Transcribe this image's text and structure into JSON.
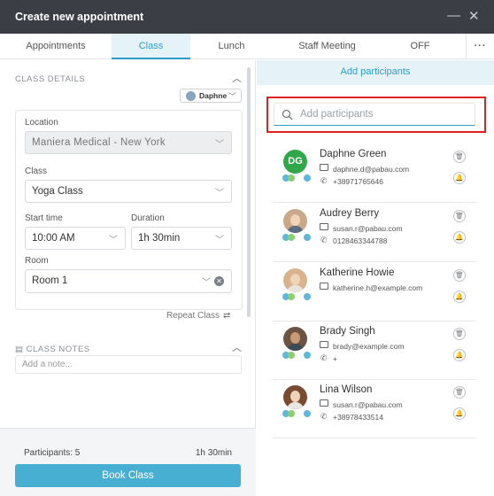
{
  "window": {
    "title": "Create new appointment",
    "minimize_glyph": "—",
    "close_glyph": "✕"
  },
  "tabs": [
    {
      "label": "Appointments"
    },
    {
      "label": "Class"
    },
    {
      "label": "Lunch"
    },
    {
      "label": "Staff Meeting"
    },
    {
      "label": "OFF"
    },
    {
      "label": "···"
    }
  ],
  "class_details": {
    "section_label": "CLASS DETAILS",
    "staff": "Daphne",
    "location_label": "Location",
    "location_value": "Maniera Medical - New York",
    "class_label": "Class",
    "class_value": "Yoga Class",
    "start_label": "Start time",
    "start_value": "10:00 AM",
    "duration_label": "Duration",
    "duration_value": "1h 30min",
    "room_label": "Room",
    "room_value": "Room 1",
    "repeat_label": "Repeat Class"
  },
  "class_notes": {
    "section_label": "CLASS NOTES",
    "placeholder": "Add a note..."
  },
  "footer": {
    "participants_text": "Participants: 5",
    "duration_text": "1h 30min",
    "book_button": "Book Class"
  },
  "participants_panel": {
    "header": "Add participants",
    "search_placeholder": "Add participants",
    "participants": [
      {
        "name": "Daphne Green",
        "initials": "DG",
        "email": "daphne.d@pabau.com",
        "phone": "+38971765646",
        "avatar": "initials"
      },
      {
        "name": "Audrey Berry",
        "email": "susan.r@pabau.com",
        "phone": "0128463344788",
        "avatar": "photo"
      },
      {
        "name": "Katherine Howie",
        "email": "katherine.h@example.com",
        "phone": "",
        "avatar": "photo"
      },
      {
        "name": "Brady Singh",
        "email": "brady@example.com",
        "phone": "+",
        "avatar": "photo"
      },
      {
        "name": "Lina Wilson",
        "email": "susan.r@pabau.com",
        "phone": "+38978433514",
        "avatar": "photo"
      }
    ]
  },
  "colors": {
    "accent": "#2c9cc8",
    "button": "#46afd2",
    "titlebar": "#3b3e45",
    "highlight": "#e02020"
  },
  "icons": [
    "close-icon",
    "minimize-icon",
    "search-icon",
    "chevron-down-icon",
    "chevron-up-icon",
    "repeat-icon",
    "mail-icon",
    "phone-icon",
    "trash-icon",
    "bell-icon",
    "notes-icon"
  ]
}
